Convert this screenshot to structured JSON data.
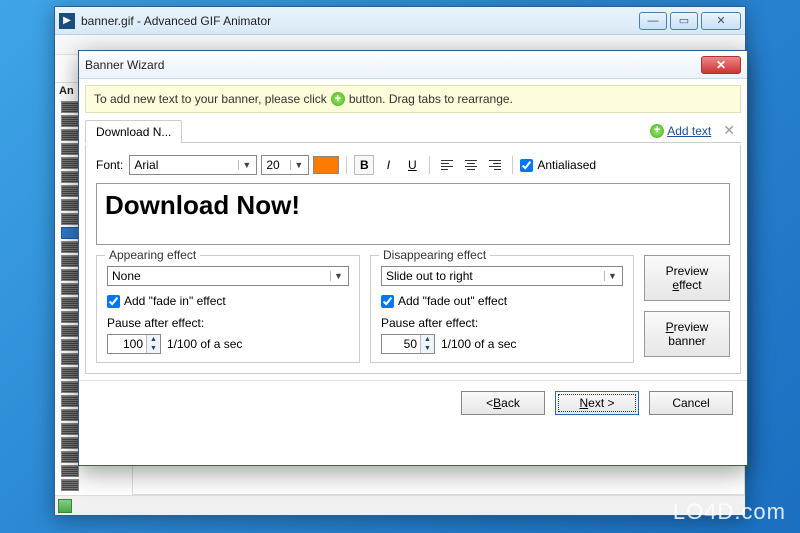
{
  "parent_window": {
    "title": "banner.gif - Advanced GIF Animator",
    "sidebar_label": "An"
  },
  "dialog": {
    "title": "Banner Wizard",
    "hint_before": "To add new text to your banner, please click",
    "hint_after": "button. Drag tabs to rearrange.",
    "tab_label": "Download N...",
    "add_text_label": "Add text",
    "font_label": "Font:",
    "font_name": "Arial",
    "font_size": "20",
    "font_color": "#ff7b00",
    "antialiased_label": "Antialiased",
    "preview_text": "Download Now!",
    "appearing": {
      "title": "Appearing effect",
      "effect": "None",
      "fade_label": "Add \"fade in\" effect",
      "fade_checked": true,
      "pause_label": "Pause after effect:",
      "pause_value": "100",
      "pause_unit": "1/100 of a sec"
    },
    "disappearing": {
      "title": "Disappearing effect",
      "effect": "Slide out to right",
      "fade_label": "Add \"fade out\" effect",
      "fade_checked": true,
      "pause_label": "Pause after effect:",
      "pause_value": "50",
      "pause_unit": "1/100 of a sec"
    },
    "preview_effect_btn": "Preview effect",
    "preview_banner_btn": "Preview banner",
    "nav": {
      "back": "< Back",
      "next": "Next >",
      "cancel": "Cancel"
    }
  },
  "watermark": "LO4D.com"
}
